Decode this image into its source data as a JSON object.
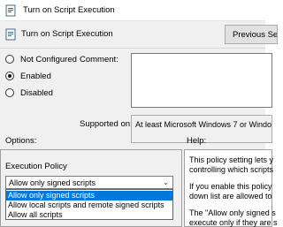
{
  "window": {
    "title": "Turn on Script Execution"
  },
  "header": {
    "title": "Turn on Script Execution",
    "previous_button": "Previous Se"
  },
  "state": {
    "options": [
      {
        "label": "Not Configured",
        "checked": false
      },
      {
        "label": "Enabled",
        "checked": true
      },
      {
        "label": "Disabled",
        "checked": false
      }
    ]
  },
  "comment": {
    "label": "Comment:",
    "value": ""
  },
  "supported": {
    "label": "Supported on:",
    "value": "At least Microsoft Windows 7 or Windows"
  },
  "options_section": {
    "label": "Options:",
    "execution_policy_label": "Execution Policy",
    "selected_value": "Allow only signed scripts",
    "dropdown_items": [
      "Allow only signed scripts",
      "Allow local scripts and remote signed scripts",
      "Allow all scripts"
    ]
  },
  "help_section": {
    "label": "Help:",
    "lines": [
      "This policy setting lets y",
      "controlling which scripts",
      "If you enable this policy",
      "down list are allowed to",
      "The \"Allow only signed s",
      "execute only if they are s"
    ]
  }
}
